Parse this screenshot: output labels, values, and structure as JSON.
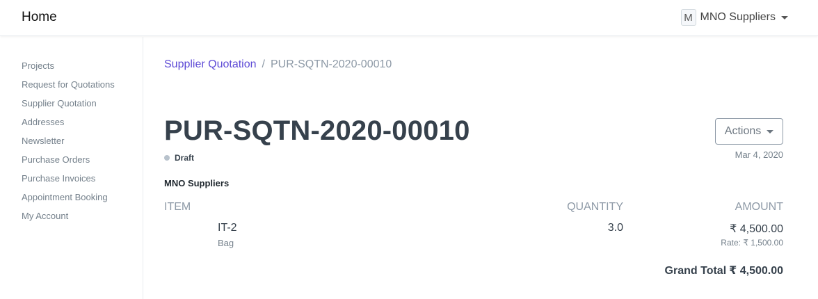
{
  "navbar": {
    "brand": "Home",
    "user": {
      "avatar_letter": "M",
      "name": "MNO Suppliers"
    }
  },
  "sidebar": {
    "items": [
      {
        "label": "Projects"
      },
      {
        "label": "Request for Quotations"
      },
      {
        "label": "Supplier Quotation"
      },
      {
        "label": "Addresses"
      },
      {
        "label": "Newsletter"
      },
      {
        "label": "Purchase Orders"
      },
      {
        "label": "Purchase Invoices"
      },
      {
        "label": "Appointment Booking"
      },
      {
        "label": "My Account"
      }
    ]
  },
  "breadcrumb": {
    "parent": "Supplier Quotation",
    "separator": "/",
    "current": "PUR-SQTN-2020-00010"
  },
  "document": {
    "title": "PUR-SQTN-2020-00010",
    "status": "Draft",
    "status_color": "#b8c2cc",
    "actions_label": "Actions",
    "date": "Mar 4, 2020",
    "party": "MNO Suppliers"
  },
  "items_table": {
    "headers": {
      "item": "ITEM",
      "quantity": "QUANTITY",
      "amount": "AMOUNT"
    },
    "rows": [
      {
        "item_code": "IT-2",
        "item_name": "Bag",
        "quantity": "3.0",
        "amount": "₹ 4,500.00",
        "rate": "Rate: ₹ 1,500.00"
      }
    ]
  },
  "totals": {
    "grand_total_label": "Grand Total",
    "grand_total_value": "₹ 4,500.00"
  },
  "colors": {
    "link": "#5e4bd6",
    "heading": "#36414c",
    "muted": "#8d99a6"
  }
}
